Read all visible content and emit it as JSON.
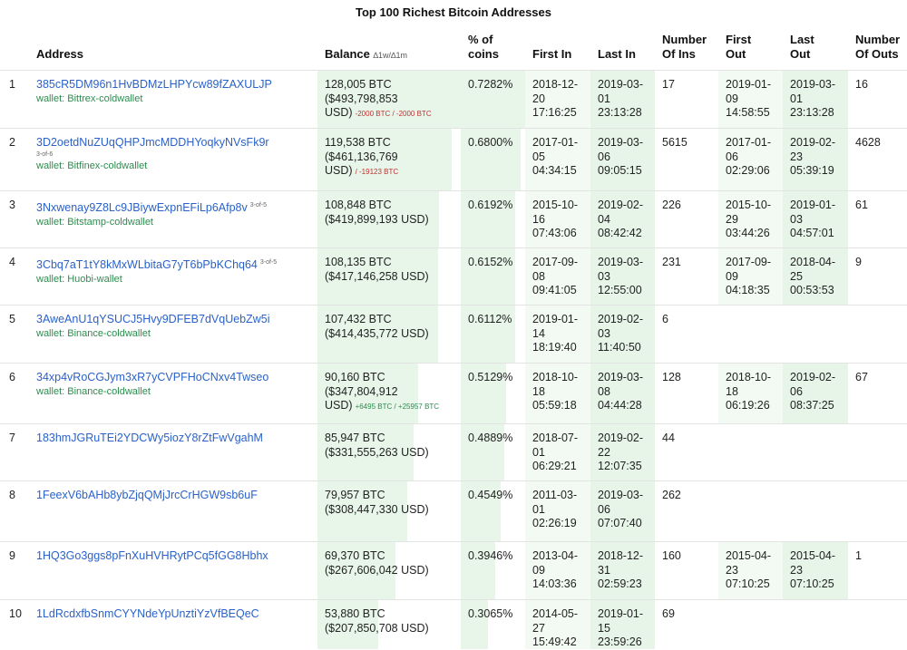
{
  "title": "Top 100 Richest Bitcoin Addresses",
  "headers": {
    "address": "Address",
    "balance": "Balance",
    "balance_sub": "∆1w/∆1m",
    "pct": "% of\ncoins",
    "first_in": "First In",
    "last_in": "Last In",
    "num_ins": "Number\nOf Ins",
    "first_out": "First\nOut",
    "last_out": "Last\nOut",
    "num_outs": "Number\nOf Outs"
  },
  "rows": [
    {
      "rank": "1",
      "address": "385cR5DM96n1HvBDMzLHPYcw89fZAXULJP",
      "sig": "",
      "wallet": "wallet: Bittrex-coldwallet",
      "btc": "128,005 BTC",
      "usd": "($493,798,853\nUSD)",
      "chg": "-2000 BTC / -2000 BTC",
      "chg_dir": "neg",
      "pct": "0.7282%",
      "pct_value": 0.7282,
      "first_in": "2018-12-\n20\n17:16:25",
      "last_in": "2019-03-\n01\n23:13:28",
      "num_ins": "17",
      "first_out": "2019-01-\n09\n14:58:55",
      "last_out": "2019-03-\n01\n23:13:28",
      "num_outs": "16"
    },
    {
      "rank": "2",
      "address": "3D2oetdNuZUqQHPJmcMDDHYoqkyNVsFk9r",
      "sig": "3-of-6",
      "wallet": "wallet: Bitfinex-coldwallet",
      "btc": "119,538 BTC",
      "usd": "($461,136,769\nUSD)",
      "chg": "/ -19123 BTC",
      "chg_dir": "neg",
      "pct": "0.6800%",
      "pct_value": 0.68,
      "first_in": "2017-01-\n05\n04:34:15",
      "last_in": "2019-03-\n06\n09:05:15",
      "num_ins": "5615",
      "first_out": "2017-01-\n06\n02:29:06",
      "last_out": "2019-02-\n23\n05:39:19",
      "num_outs": "4628"
    },
    {
      "rank": "3",
      "address": "3Nxwenay9Z8Lc9JBiywExpnEFiLp6Afp8v",
      "sig": "3-of-5",
      "wallet": "wallet: Bitstamp-coldwallet",
      "btc": "108,848 BTC",
      "usd": "($419,899,193 USD)",
      "chg": "",
      "chg_dir": "",
      "pct": "0.6192%",
      "pct_value": 0.6192,
      "first_in": "2015-10-\n16\n07:43:06",
      "last_in": "2019-02-\n04\n08:42:42",
      "num_ins": "226",
      "first_out": "2015-10-\n29\n03:44:26",
      "last_out": "2019-01-\n03\n04:57:01",
      "num_outs": "61"
    },
    {
      "rank": "4",
      "address": "3Cbq7aT1tY8kMxWLbitaG7yT6bPbKChq64",
      "sig": "3-of-5",
      "wallet": "wallet: Huobi-wallet",
      "btc": "108,135 BTC",
      "usd": "($417,146,258 USD)",
      "chg": "",
      "chg_dir": "",
      "pct": "0.6152%",
      "pct_value": 0.6152,
      "first_in": "2017-09-\n08\n09:41:05",
      "last_in": "2019-03-\n03\n12:55:00",
      "num_ins": "231",
      "first_out": "2017-09-\n09\n04:18:35",
      "last_out": "2018-04-\n25\n00:53:53",
      "num_outs": "9"
    },
    {
      "rank": "5",
      "address": "3AweAnU1qYSUCJ5Hvy9DFEB7dVqUebZw5i",
      "sig": "",
      "wallet": "wallet: Binance-coldwallet",
      "btc": "107,432 BTC",
      "usd": "($414,435,772 USD)",
      "chg": "",
      "chg_dir": "",
      "pct": "0.6112%",
      "pct_value": 0.6112,
      "first_in": "2019-01-\n14\n18:19:40",
      "last_in": "2019-02-\n03\n11:40:50",
      "num_ins": "6",
      "first_out": "",
      "last_out": "",
      "num_outs": ""
    },
    {
      "rank": "6",
      "address": "34xp4vRoCGJym3xR7yCVPFHoCNxv4Twseo",
      "sig": "",
      "wallet": "wallet: Binance-coldwallet",
      "btc": "90,160 BTC",
      "usd": "($347,804,912\nUSD)",
      "chg": "+6495 BTC / +25957 BTC",
      "chg_dir": "pos",
      "pct": "0.5129%",
      "pct_value": 0.5129,
      "first_in": "2018-10-\n18\n05:59:18",
      "last_in": "2019-03-\n08\n04:44:28",
      "num_ins": "128",
      "first_out": "2018-10-\n18\n06:19:26",
      "last_out": "2019-02-\n06\n08:37:25",
      "num_outs": "67"
    },
    {
      "rank": "7",
      "address": "183hmJGRuTEi2YDCWy5iozY8rZtFwVgahM",
      "sig": "",
      "wallet": "",
      "btc": "85,947 BTC",
      "usd": "($331,555,263 USD)",
      "chg": "",
      "chg_dir": "",
      "pct": "0.4889%",
      "pct_value": 0.4889,
      "first_in": "2018-07-\n01\n06:29:21",
      "last_in": "2019-02-\n22\n12:07:35",
      "num_ins": "44",
      "first_out": "",
      "last_out": "",
      "num_outs": ""
    },
    {
      "rank": "8",
      "address": "1FeexV6bAHb8ybZjqQMjJrcCrHGW9sb6uF",
      "sig": "",
      "wallet": "",
      "btc": "79,957 BTC",
      "usd": "($308,447,330 USD)",
      "chg": "",
      "chg_dir": "",
      "pct": "0.4549%",
      "pct_value": 0.4549,
      "first_in": "2011-03-\n01\n02:26:19",
      "last_in": "2019-03-\n06\n07:07:40",
      "num_ins": "262",
      "first_out": "",
      "last_out": "",
      "num_outs": ""
    },
    {
      "rank": "9",
      "address": "1HQ3Go3ggs8pFnXuHVHRytPCq5fGG8Hbhx",
      "sig": "",
      "wallet": "",
      "btc": "69,370 BTC",
      "usd": "($267,606,042 USD)",
      "chg": "",
      "chg_dir": "",
      "pct": "0.3946%",
      "pct_value": 0.3946,
      "first_in": "2013-04-\n09\n14:03:36",
      "last_in": "2018-12-\n31\n02:59:23",
      "num_ins": "160",
      "first_out": "2015-04-\n23\n07:10:25",
      "last_out": "2015-04-\n23\n07:10:25",
      "num_outs": "1"
    },
    {
      "rank": "10",
      "address": "1LdRcdxfbSnmCYYNdeYpUnztiYzVfBEQeC",
      "sig": "",
      "wallet": "",
      "btc": "53,880 BTC",
      "usd": "($207,850,708 USD)",
      "chg": "",
      "chg_dir": "",
      "pct": "0.3065%",
      "pct_value": 0.3065,
      "first_in": "2014-05-\n27\n15:49:42",
      "last_in": "2019-01-\n15\n23:59:26",
      "num_ins": "69",
      "first_out": "",
      "last_out": "",
      "num_outs": ""
    }
  ]
}
